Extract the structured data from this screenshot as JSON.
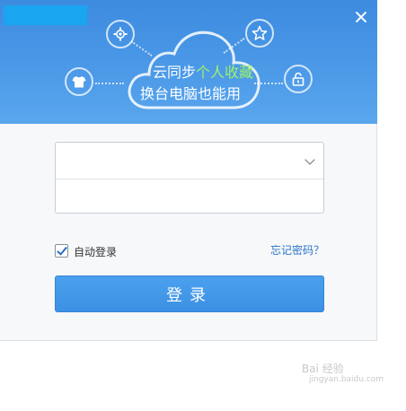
{
  "banner": {
    "cloud_line1_a": "云同步",
    "cloud_line1_b": "个人收藏",
    "cloud_line2": "换台电脑也能用"
  },
  "form": {
    "account_placeholder": "",
    "password_placeholder": ""
  },
  "options": {
    "auto_login": "自动登录",
    "forgot_password": "忘记密码？"
  },
  "login_button": "登录",
  "watermark": {
    "line1": "Bai 经验",
    "line2": "jingyan.baidu.com"
  },
  "colors": {
    "banner_blue": "#4a95e6",
    "button_blue": "#4396e8",
    "link_blue": "#2a74c8",
    "highlight_green": "#9cf36a"
  }
}
